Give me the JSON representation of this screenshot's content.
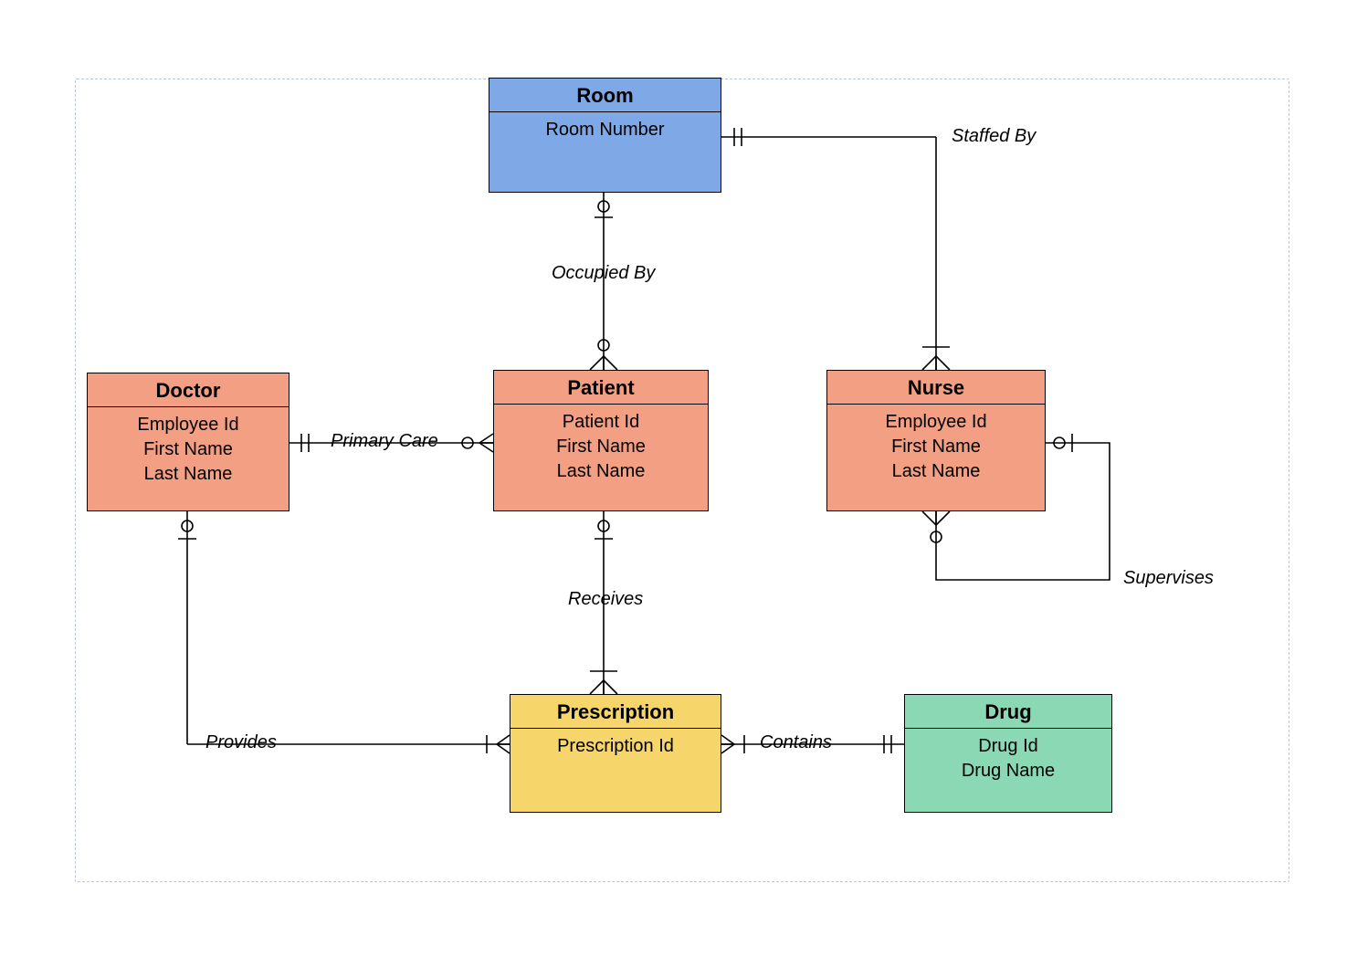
{
  "entities": {
    "room": {
      "title": "Room",
      "attrs": [
        "Room Number"
      ]
    },
    "doctor": {
      "title": "Doctor",
      "attrs": [
        "Employee Id",
        "First Name",
        "Last Name"
      ]
    },
    "patient": {
      "title": "Patient",
      "attrs": [
        "Patient Id",
        "First Name",
        "Last Name"
      ]
    },
    "nurse": {
      "title": "Nurse",
      "attrs": [
        "Employee Id",
        "First Name",
        "Last Name"
      ]
    },
    "prescription": {
      "title": "Prescription",
      "attrs": [
        "Prescription Id"
      ]
    },
    "drug": {
      "title": "Drug",
      "attrs": [
        "Drug Id",
        "Drug Name"
      ]
    }
  },
  "relationships": {
    "staffed_by": "Staffed By",
    "occupied_by": "Occupied By",
    "primary_care": "Primary Care",
    "receives": "Receives",
    "provides": "Provides",
    "contains": "Contains",
    "supervises": "Supervises"
  }
}
